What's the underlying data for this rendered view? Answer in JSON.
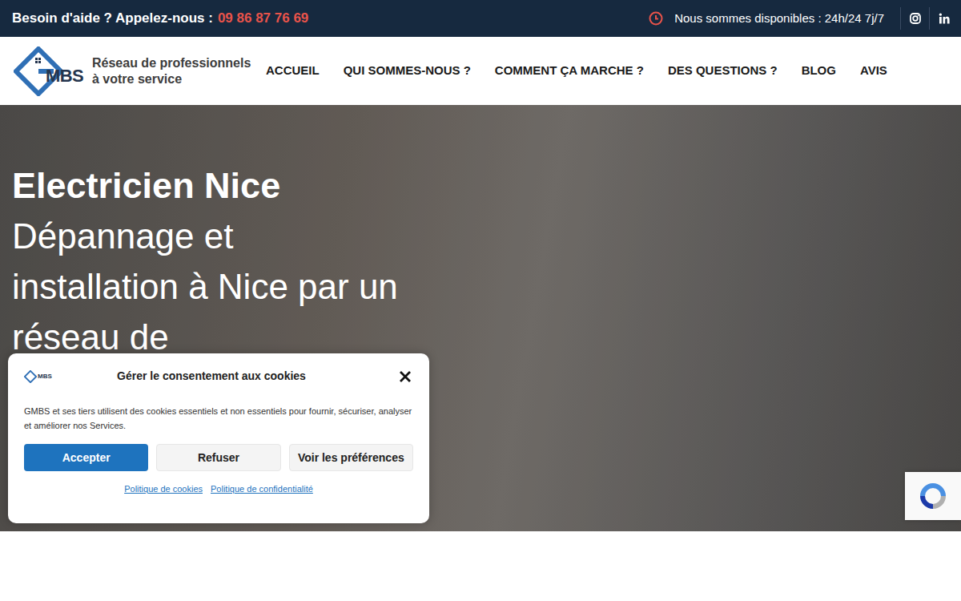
{
  "topbar": {
    "help_text": "Besoin d'aide ? Appelez-nous :",
    "phone": "09 86 87 76 69",
    "availability": "Nous sommes disponibles : 24h/24 7j/7"
  },
  "logo": {
    "text": "MBS",
    "tagline_line1": "Réseau de professionnels",
    "tagline_line2": "à votre service"
  },
  "nav": [
    "ACCUEIL",
    "QUI SOMMES-NOUS ?",
    "COMMENT ÇA MARCHE ?",
    "DES QUESTIONS ?",
    "BLOG",
    "AVIS"
  ],
  "hero": {
    "title": "Electricien Nice",
    "subtitle": "Dépannage et installation à Nice par un réseau de"
  },
  "cookie_dialog": {
    "logo_text": "MBS",
    "title": "Gérer le consentement aux cookies",
    "body": "GMBS et ses tiers utilisent des cookies essentiels et non essentiels pour fournir, sécuriser, analyser et améliorer nos Services.",
    "buttons": [
      {
        "label": "Accepter",
        "kind": "primary"
      },
      {
        "label": "Refuser",
        "kind": "secondary"
      },
      {
        "label": "Voir les préférences",
        "kind": "secondary"
      }
    ],
    "links": [
      "Politique de cookies",
      "Politique de confidentialité"
    ]
  }
}
